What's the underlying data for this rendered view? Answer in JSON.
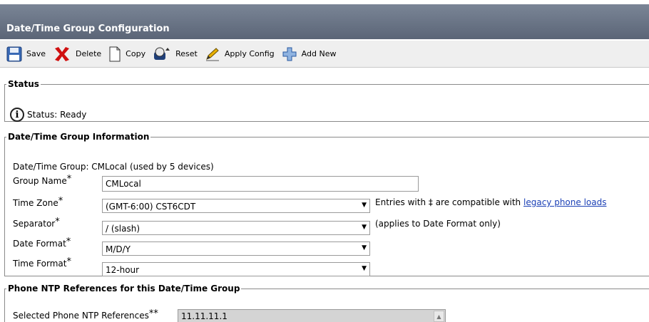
{
  "page_title": "Date/Time Group Configuration",
  "toolbar": {
    "save": "Save",
    "delete": "Delete",
    "copy": "Copy",
    "reset": "Reset",
    "apply_config": "Apply Config",
    "add_new": "Add New"
  },
  "status": {
    "legend": "Status",
    "text": "Status: Ready"
  },
  "info": {
    "legend": "Date/Time Group Information",
    "group_line": "Date/Time Group:  CMLocal  (used by 5 devices)",
    "group_name_label": "Group Name",
    "group_name_value": "CMLocal",
    "time_zone_label": "Time Zone",
    "time_zone_value": "(GMT-6:00) CST6CDT",
    "tz_note": "Entries with ‡ are compatible with",
    "tz_link": "legacy phone loads",
    "separator_label": "Separator",
    "separator_value": "/ (slash)",
    "separator_note": "(applies to Date Format only)",
    "date_format_label": "Date Format",
    "date_format_value": "M/D/Y",
    "time_format_label": "Time Format",
    "time_format_value": "12-hour",
    "required_mark": "*"
  },
  "ntp": {
    "legend": "Phone NTP References for this Date/Time Group",
    "selected_label": "Selected Phone NTP References",
    "required_mark": "**",
    "selected_values": [
      "11.11.11.1"
    ]
  },
  "colors": {
    "title_bar": "#5b6577",
    "delete_red": "#d01010",
    "save_blue": "#3a6ab5",
    "link": "#1a3fb5"
  }
}
